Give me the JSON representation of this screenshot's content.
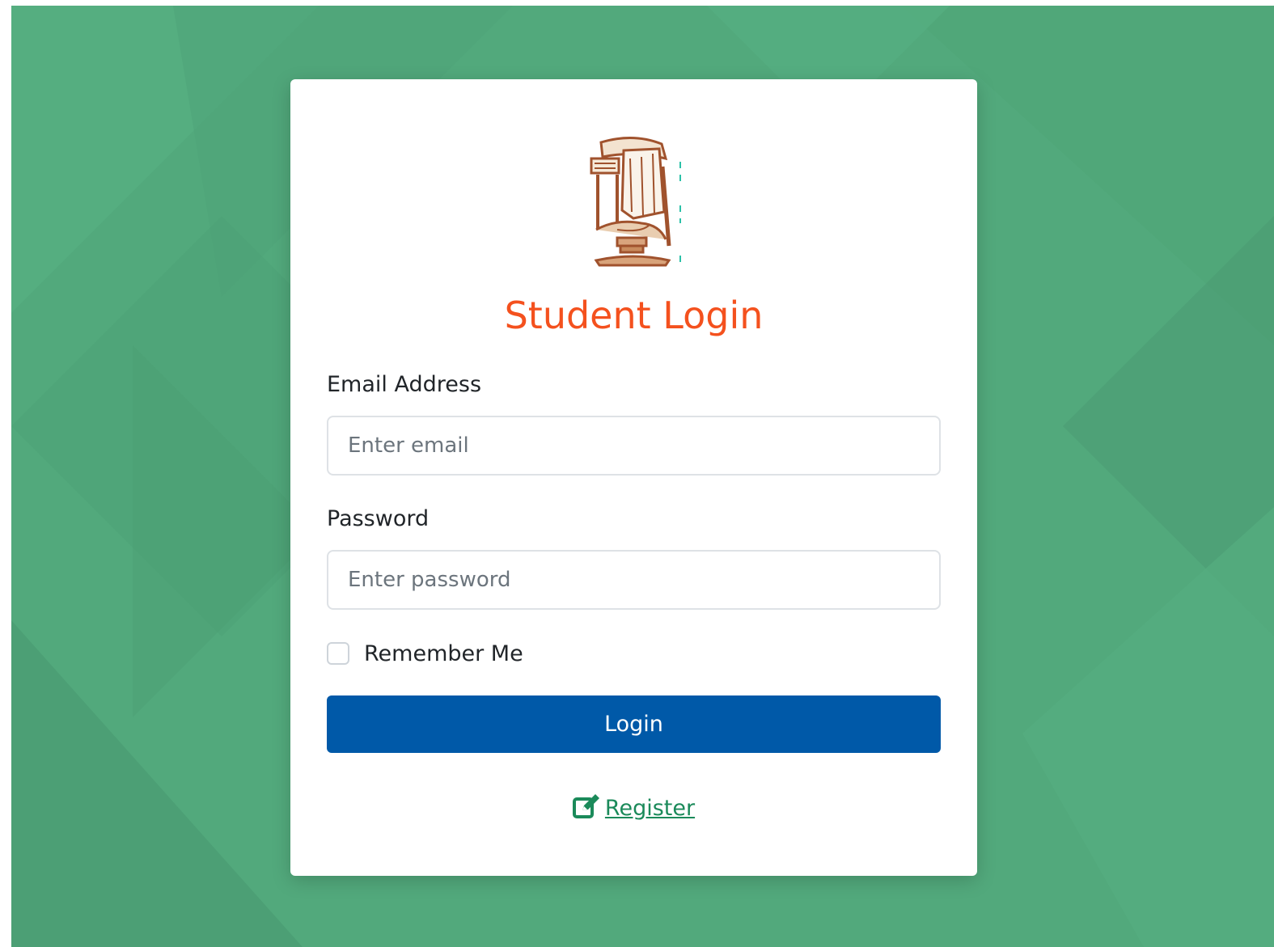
{
  "page": {
    "title": "Student Login",
    "background_color": "#52a97c",
    "accent_title_color": "#f4511e",
    "button_color": "#0059a8",
    "link_color": "#1b8a5a"
  },
  "logo": {
    "icon": "institution-logo-icon"
  },
  "form": {
    "email_label": "Email Address",
    "email_placeholder": "Enter email",
    "email_value": "",
    "password_label": "Password",
    "password_placeholder": "Enter password",
    "password_value": "",
    "remember_label": "Remember Me",
    "remember_checked": false,
    "login_label": "Login"
  },
  "register": {
    "icon": "edit-icon",
    "label": "Register"
  }
}
